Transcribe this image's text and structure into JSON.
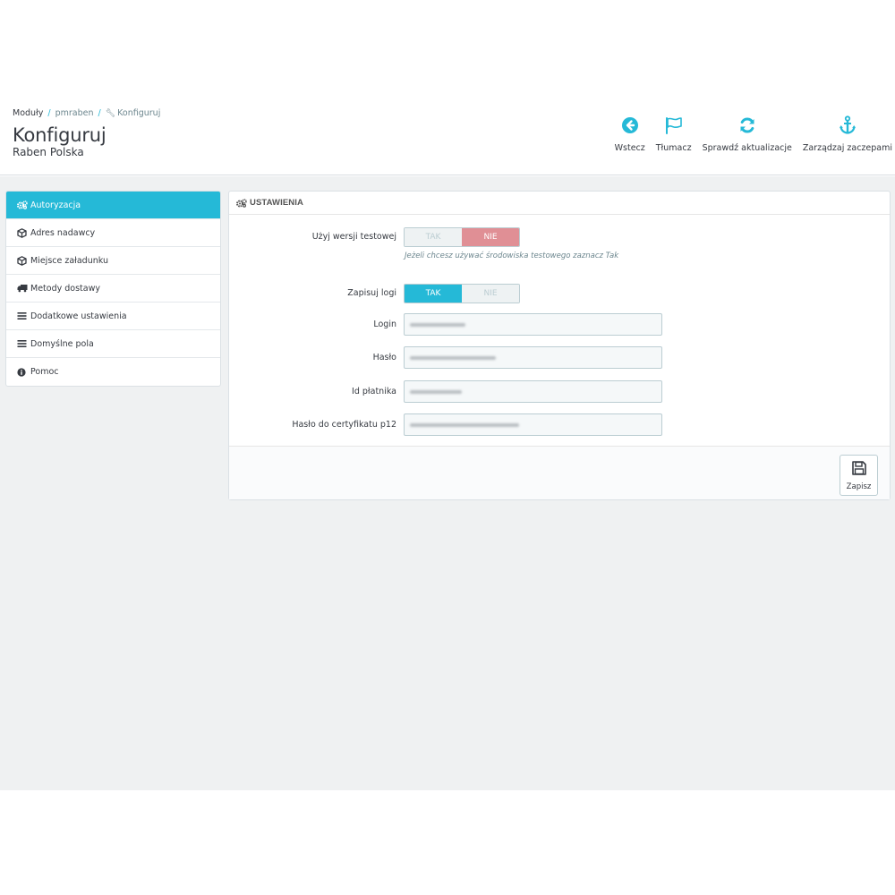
{
  "breadcrumb": {
    "items": [
      "Moduły",
      "pmraben",
      "Konfiguruj"
    ]
  },
  "page": {
    "title": "Konfiguruj",
    "subtitle": "Raben Polska"
  },
  "toolbar": [
    {
      "label": "Wstecz",
      "icon": "arrow-circle-left-icon"
    },
    {
      "label": "Tłumacz",
      "icon": "flag-icon"
    },
    {
      "label": "Sprawdź aktualizacje",
      "icon": "refresh-icon"
    },
    {
      "label": "Zarządzaj zaczepami",
      "icon": "anchor-icon"
    }
  ],
  "sidebar": {
    "items": [
      {
        "label": "Autoryzacja",
        "icon": "cogs-icon",
        "active": true
      },
      {
        "label": "Adres nadawcy",
        "icon": "cube-icon"
      },
      {
        "label": "Miejsce załadunku",
        "icon": "cube-icon"
      },
      {
        "label": "Metody dostawy",
        "icon": "truck-icon"
      },
      {
        "label": "Dodatkowe ustawienia",
        "icon": "list-icon"
      },
      {
        "label": "Domyślne pola",
        "icon": "list-icon"
      },
      {
        "label": "Pomoc",
        "icon": "info-circle-icon"
      }
    ]
  },
  "panel": {
    "heading": "USTAWIENIA",
    "test_mode": {
      "label": "Użyj wersji testowej",
      "yes": "TAK",
      "no": "NIE",
      "value": "NIE",
      "help": "Jeżeli chcesz używać środowiska testowego zaznacz Tak"
    },
    "save_logs": {
      "label": "Zapisuj logi",
      "yes": "TAK",
      "no": "NIE",
      "value": "TAK"
    },
    "fields": {
      "login_label": "Login",
      "password_label": "Hasło",
      "payer_label": "Id płatnika",
      "cert_label": "Hasło do certyfikatu p12"
    },
    "save_label": "Zapisz"
  },
  "colors": {
    "accent": "#25b9d7",
    "danger": "#e08f95",
    "background": "#eff1f2"
  }
}
